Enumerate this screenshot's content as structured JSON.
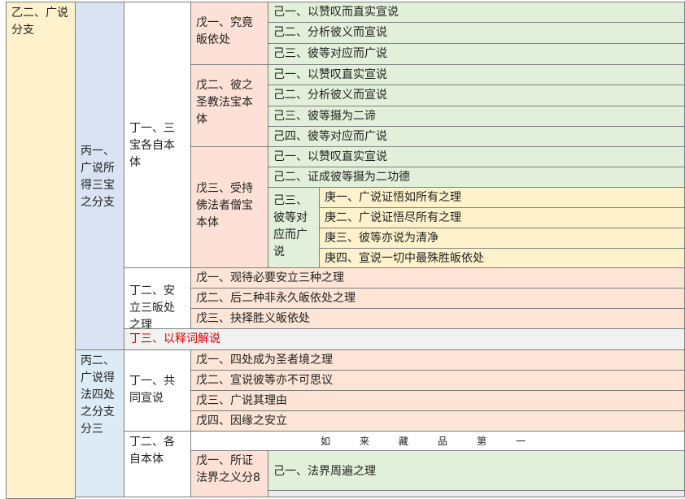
{
  "outline": {
    "yi": "乙二、广说分支",
    "bing1": "丙一、广说所得三宝之分支",
    "bing2": "丙二、广说得法四处之分支分三",
    "ding1": "丁一、三宝各自本体",
    "ding2": "丁二、安立三皈处之理",
    "ding3": "丁三、以释词解说",
    "ding_b1": "丁一、共同宣说",
    "ding_b2": "丁二、各自本体",
    "wu1": "戊一、究竟皈依处",
    "wu2": "戊二、彼之圣教法宝本体",
    "wu3": "戊三、受持佛法者僧宝本体",
    "wu1_items": [
      "己一、以赞叹而直实宣说",
      "己二、分析彼义而宣说",
      "己三、彼等对应而广说"
    ],
    "wu2_items": [
      "己一、以赞叹直实宣说",
      "己二、分析彼义而宣说",
      "己三、彼等摄为二谛",
      "己四、彼等对应而广说"
    ],
    "wu3_items": [
      "己一、以赞叹直实宣说",
      "己二、证成彼等摄为二功德"
    ],
    "ji3_label": "己三、彼等对应而广说",
    "geng_items": [
      "庚一、广说证悟如所有之理",
      "庚二、广说证悟尽所有之理",
      "庚三、彼等亦说为清净",
      "庚四、宣说一切中最殊胜皈依处"
    ],
    "ding2_items": [
      "戊一、观待必要安立三种之理",
      "戊二、后二种非永久皈依处之理",
      "戊三、抉择胜义皈依处"
    ],
    "common_items": [
      "戊一、四处成为圣者境之理",
      "戊二、宣说彼等亦不可思议",
      "戊三、广说其理由",
      "戊四、因缘之安立"
    ],
    "banner": "如来藏品第一",
    "wu_b1": "戊一、所证法界之义分8",
    "wu_b1_item": "己一、法界周遍之理"
  }
}
